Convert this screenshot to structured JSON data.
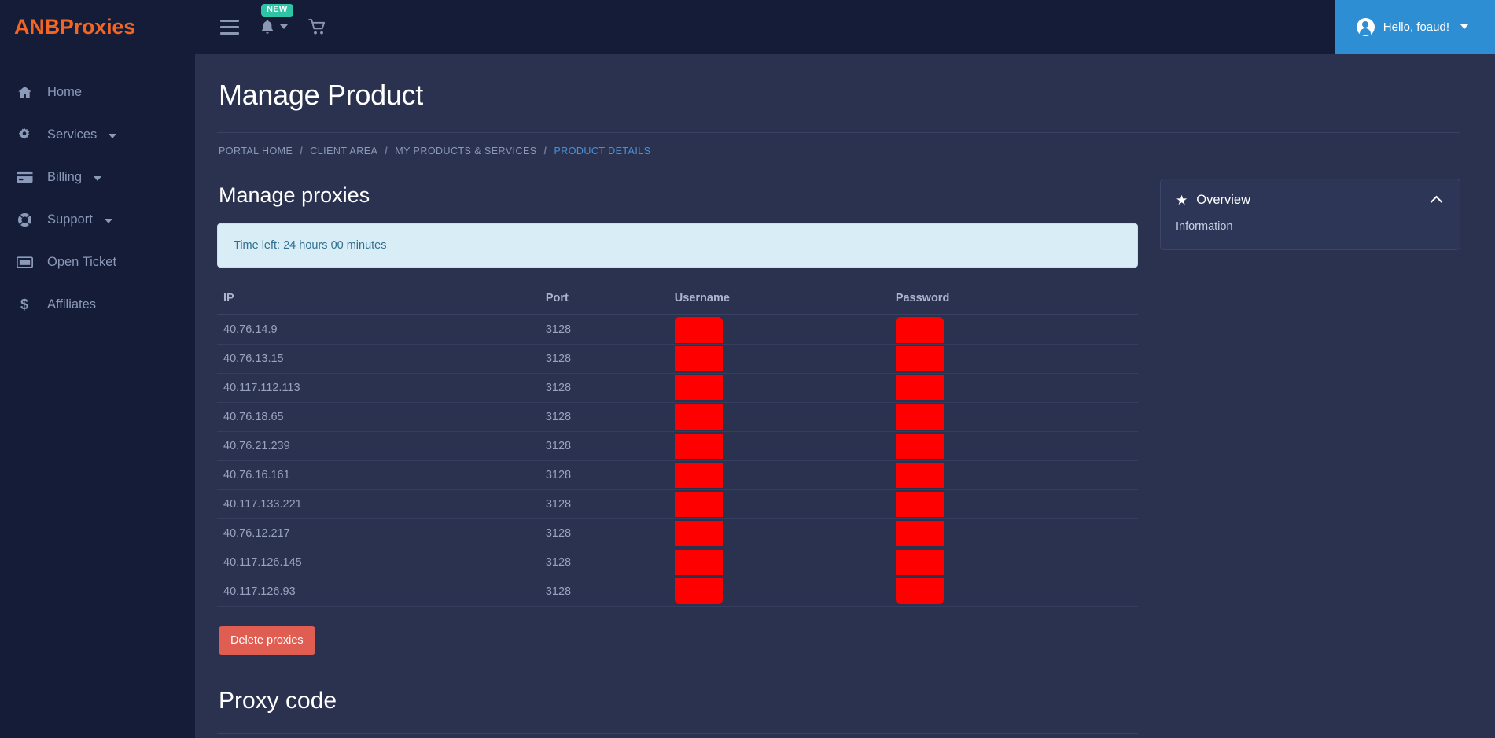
{
  "brand": {
    "name": "ANBProxies"
  },
  "topbar": {
    "menu_icon": "hamburger-icon",
    "notifications_icon": "bell-icon",
    "notifications_badge": "NEW",
    "cart_icon": "cart-icon",
    "user_greeting": "Hello, foaud!"
  },
  "sidebar": {
    "items": [
      {
        "label": "Home",
        "icon": "home-icon",
        "has_caret": false
      },
      {
        "label": "Services",
        "icon": "gear-icon",
        "has_caret": true
      },
      {
        "label": "Billing",
        "icon": "credit-card-icon",
        "has_caret": true
      },
      {
        "label": "Support",
        "icon": "lifebuoy-icon",
        "has_caret": true
      },
      {
        "label": "Open Ticket",
        "icon": "ticket-icon",
        "has_caret": false
      },
      {
        "label": "Affiliates",
        "icon": "dollar-icon",
        "has_caret": false
      }
    ]
  },
  "page": {
    "title": "Manage Product",
    "breadcrumb": [
      {
        "label": "PORTAL HOME",
        "active": false
      },
      {
        "label": "CLIENT AREA",
        "active": false
      },
      {
        "label": "MY PRODUCTS & SERVICES",
        "active": false
      },
      {
        "label": "PRODUCT DETAILS",
        "active": true
      }
    ],
    "breadcrumb_separator": "/"
  },
  "main": {
    "section_title": "Manage proxies",
    "alert_text": "Time left: 24 hours 00 minutes",
    "table": {
      "headers": [
        "IP",
        "Port",
        "Username",
        "Password"
      ],
      "rows": [
        {
          "ip": "40.76.14.9",
          "port": "3128",
          "username": "",
          "password": ""
        },
        {
          "ip": "40.76.13.15",
          "port": "3128",
          "username": "",
          "password": ""
        },
        {
          "ip": "40.117.112.113",
          "port": "3128",
          "username": "",
          "password": ""
        },
        {
          "ip": "40.76.18.65",
          "port": "3128",
          "username": "",
          "password": ""
        },
        {
          "ip": "40.76.21.239",
          "port": "3128",
          "username": "",
          "password": ""
        },
        {
          "ip": "40.76.16.161",
          "port": "3128",
          "username": "",
          "password": ""
        },
        {
          "ip": "40.117.133.221",
          "port": "3128",
          "username": "",
          "password": ""
        },
        {
          "ip": "40.76.12.217",
          "port": "3128",
          "username": "",
          "password": ""
        },
        {
          "ip": "40.117.126.145",
          "port": "3128",
          "username": "",
          "password": ""
        },
        {
          "ip": "40.117.126.93",
          "port": "3128",
          "username": "",
          "password": ""
        }
      ]
    },
    "delete_button": "Delete proxies",
    "bottom_section_title": "Proxy code"
  },
  "side_panel": {
    "title": "Overview",
    "star_icon": "star-icon",
    "collapse_icon": "chevron-up-icon",
    "links": [
      {
        "label": "Information"
      }
    ]
  },
  "colors": {
    "brand_orange": "#f26522",
    "user_blue": "#2e8ed4",
    "badge_teal": "#2ec4a6",
    "danger_red": "#e05d52",
    "redaction_red": "#ff0000",
    "alert_bg": "#d9edf7",
    "page_bg": "#2b3250",
    "chrome_bg": "#141c38"
  }
}
